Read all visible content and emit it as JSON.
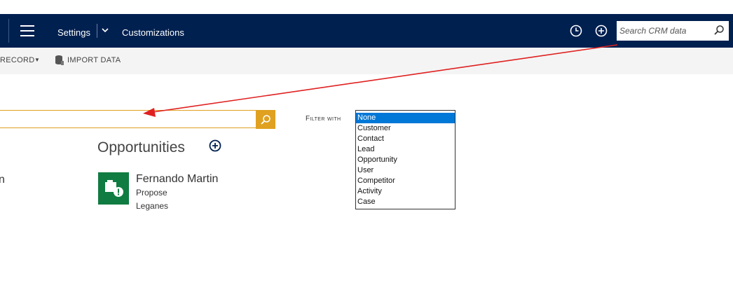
{
  "header": {
    "nav_settings": "Settings",
    "nav_customizations": "Customizations",
    "search_placeholder": "Search CRM data"
  },
  "commandbar": {
    "record_label": "RECORD",
    "import_label": "IMPORT DATA"
  },
  "search": {
    "value": ""
  },
  "filter": {
    "label": "Filter with",
    "options": [
      "None",
      "Customer",
      "Contact",
      "Lead",
      "Opportunity",
      "User",
      "Competitor",
      "Activity",
      "Case"
    ],
    "selected": "None"
  },
  "results": {
    "left_fragment": "n",
    "section_title": "Opportunities",
    "cards": [
      {
        "name": "Fernando Martin",
        "line1": "Propose",
        "line2": "Leganes"
      }
    ]
  },
  "colors": {
    "topbar": "#002050",
    "accent_orange": "#e0a020",
    "tile_green": "#107c41",
    "selection_blue": "#0078d7",
    "annotation_red": "#e02020"
  },
  "icons": [
    "hamburger-icon",
    "chevron-down-icon",
    "history-icon",
    "add-circle-icon",
    "search-icon",
    "import-data-icon",
    "opportunity-icon"
  ]
}
